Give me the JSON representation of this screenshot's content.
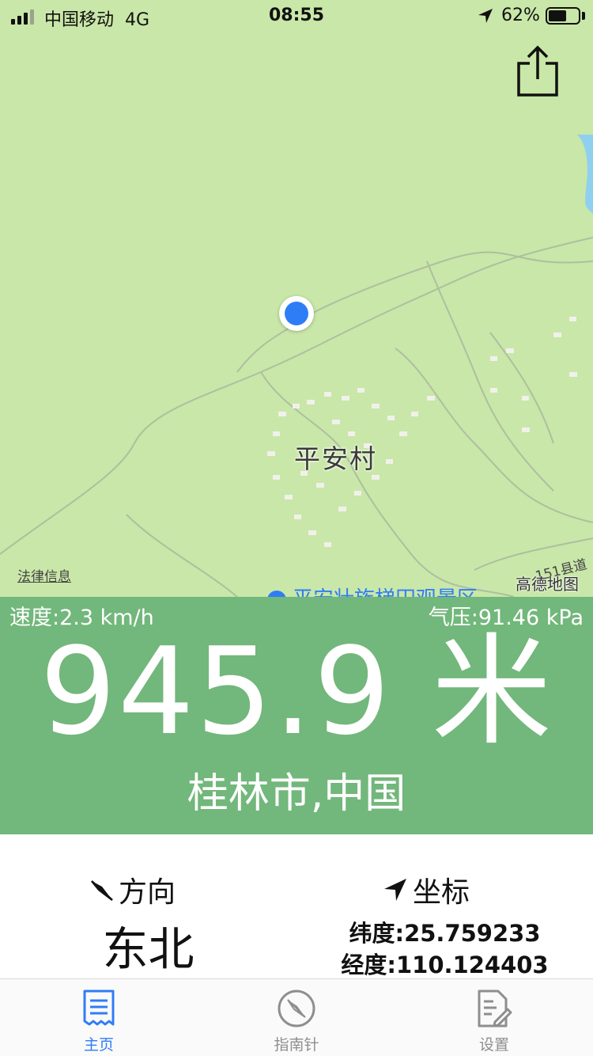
{
  "status_bar": {
    "carrier": "中国移动",
    "network": "4G",
    "time": "08:55",
    "battery_percent_label": "62%",
    "battery_level": 0.62
  },
  "map": {
    "village_label": "平安村",
    "legal_link": "法律信息",
    "road_label": "151县道",
    "brand": "高德地图",
    "poi_label": "平安壮族梯田观景区"
  },
  "altitude_panel": {
    "speed": "速度:2.3 km/h",
    "pressure": "气压:91.46 kPa",
    "altitude": "945.9 米",
    "city": "桂林市,中国",
    "background_color": "#72b77b"
  },
  "info": {
    "direction_title": "方向",
    "direction_value": "东北",
    "coord_title": "坐标",
    "latitude": "纬度:25.759233",
    "longitude": "经度:110.124403"
  },
  "tabs": [
    {
      "label": "主页",
      "icon": "document-icon",
      "active": true
    },
    {
      "label": "指南针",
      "icon": "compass-icon",
      "active": false
    },
    {
      "label": "设置",
      "icon": "settings-doc-icon",
      "active": false
    }
  ],
  "colors": {
    "accent": "#2f7df6",
    "map_bg": "#c9e7a8"
  }
}
